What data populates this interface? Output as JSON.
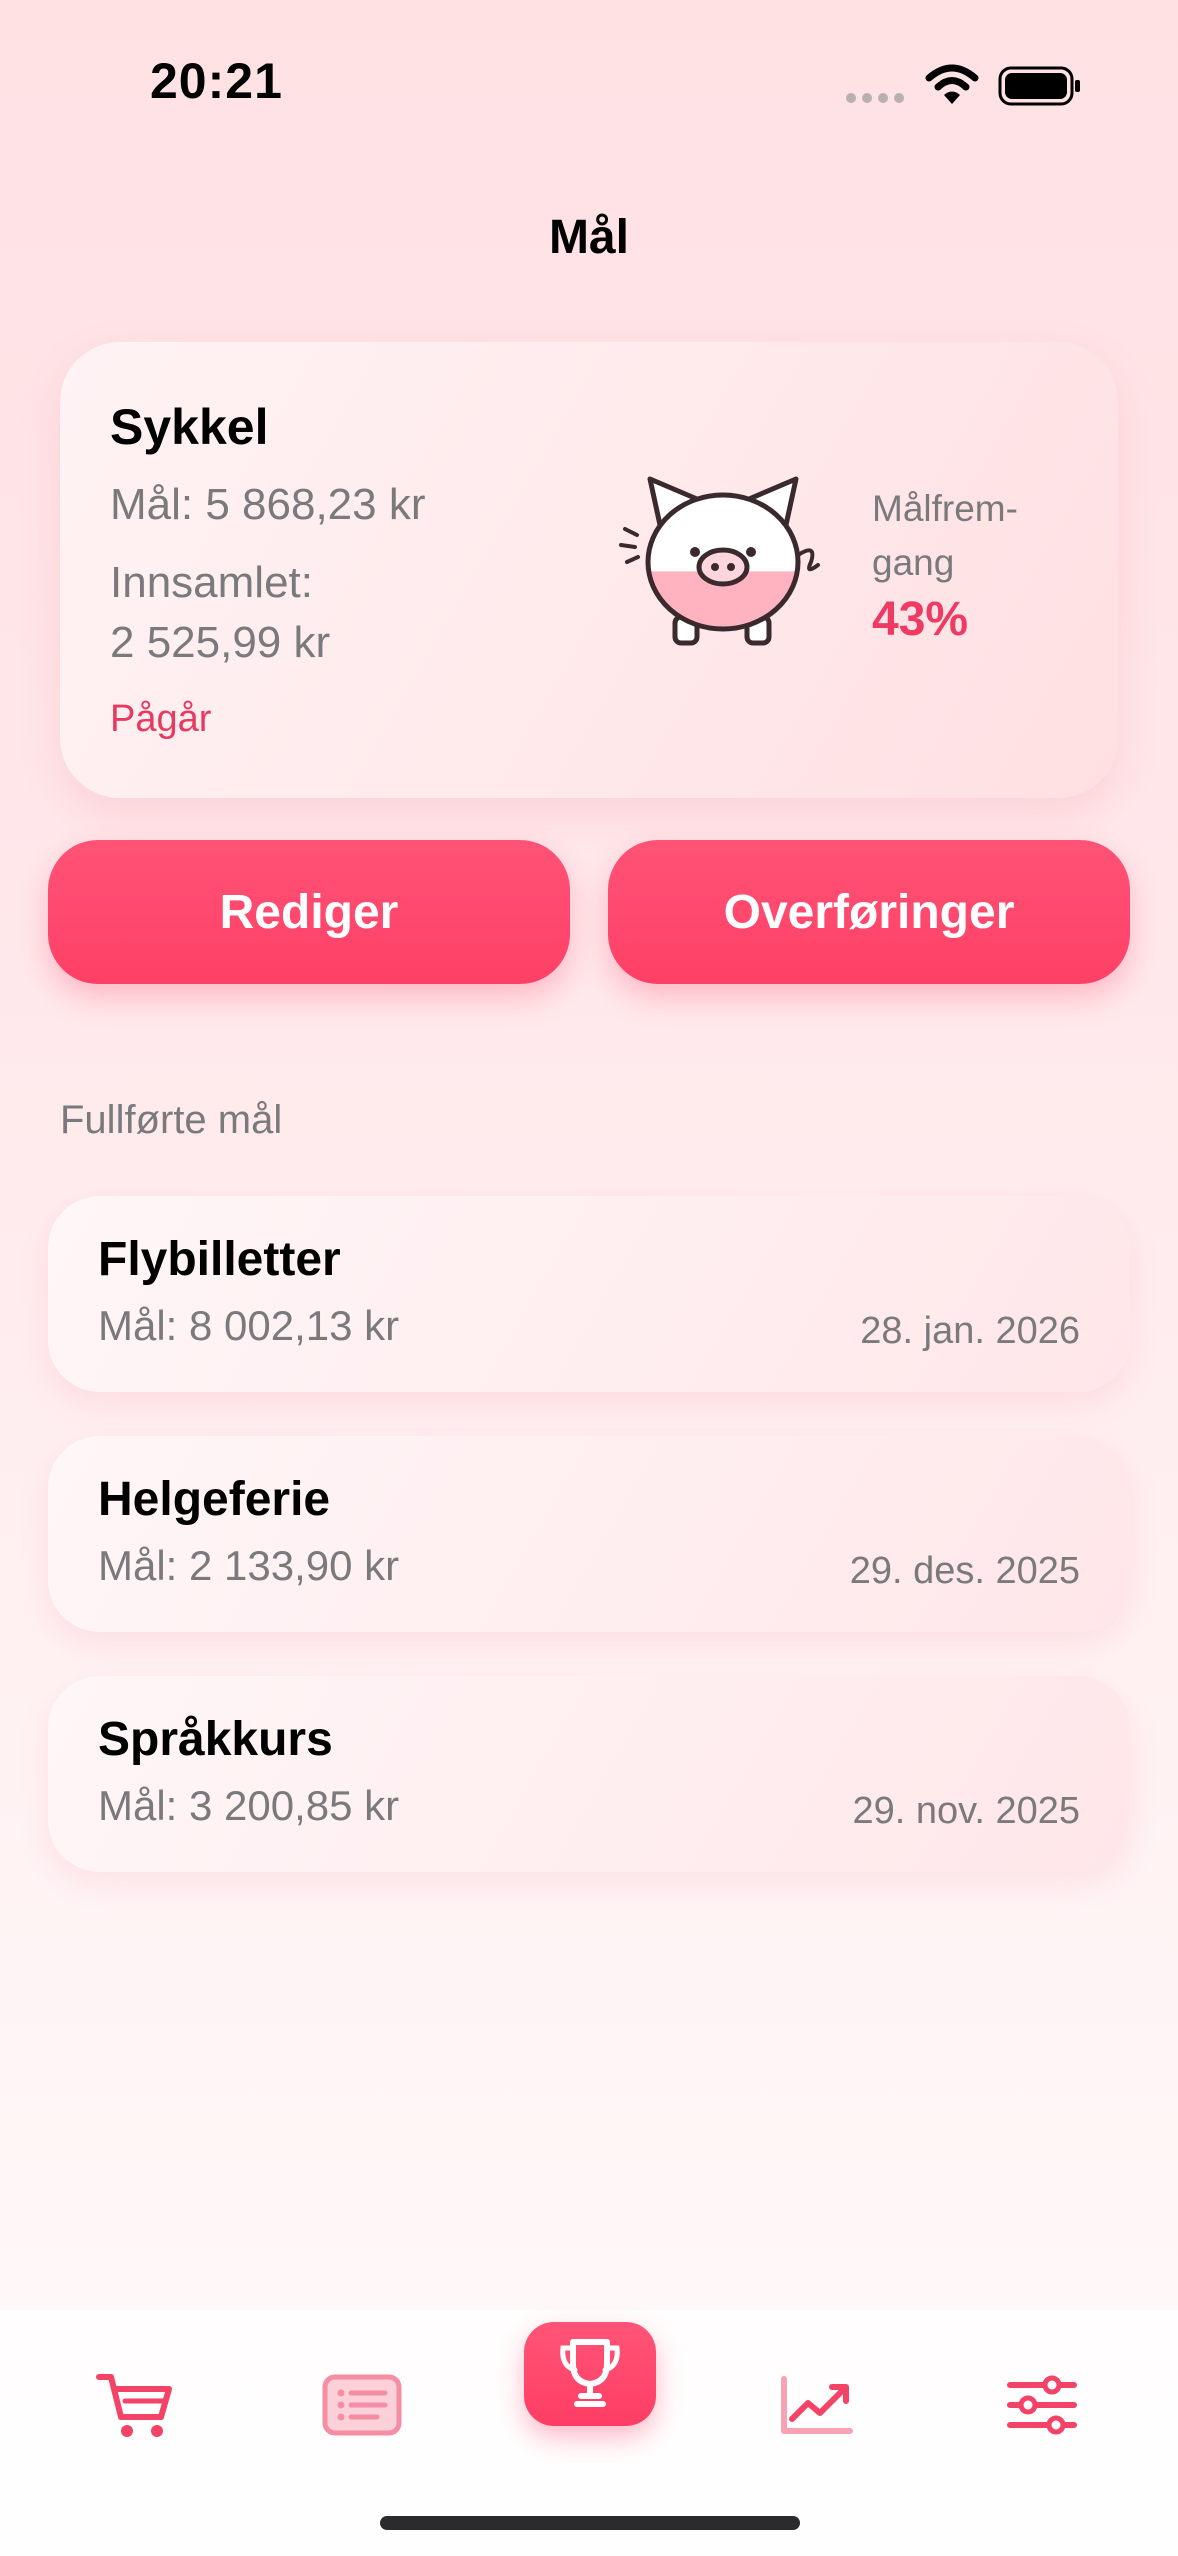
{
  "status_bar": {
    "time": "20:21",
    "icons": [
      "signal-dots-icon",
      "wifi-icon",
      "battery-icon"
    ]
  },
  "page": {
    "title": "Mål"
  },
  "current_goal": {
    "name": "Sykkel",
    "target": "Mål: 5 868,23 kr",
    "collected_label": "Innsamlet:",
    "collected_value": "2 525,99 kr",
    "status": "Pågår",
    "progress_label": "Målfrem-gang",
    "progress_label_line1": "Målfrem-",
    "progress_label_line2": "gang",
    "progress_value": "43%",
    "progress_fraction": 0.43,
    "icon": "piggy-bank-icon"
  },
  "actions": {
    "edit_label": "Rediger",
    "transfers_label": "Overføringer"
  },
  "completed": {
    "heading": "Fullførte mål",
    "items": [
      {
        "name": "Flybilletter",
        "target": "Mål: 8 002,13 kr",
        "date": "28. jan. 2026"
      },
      {
        "name": "Helgeferie",
        "target": "Mål: 2 133,90 kr",
        "date": "29. des. 2025"
      },
      {
        "name": "Språkkurs",
        "target": "Mål: 3 200,85 kr",
        "date": "29. nov. 2025"
      }
    ]
  },
  "tab_bar": {
    "tabs": [
      {
        "icon": "cart-icon",
        "selected": false
      },
      {
        "icon": "list-icon",
        "selected": false
      },
      {
        "icon": "trophy-icon",
        "selected": true
      },
      {
        "icon": "chart-icon",
        "selected": false
      },
      {
        "icon": "sliders-icon",
        "selected": false
      }
    ]
  },
  "colors": {
    "accent": "#ff4168",
    "accent_text": "#ee3b63",
    "status_text": "#e73a5f",
    "secondary_text": "#7a7a7d",
    "background_top": "#ffe1e4",
    "background_bottom": "#fffafa"
  }
}
